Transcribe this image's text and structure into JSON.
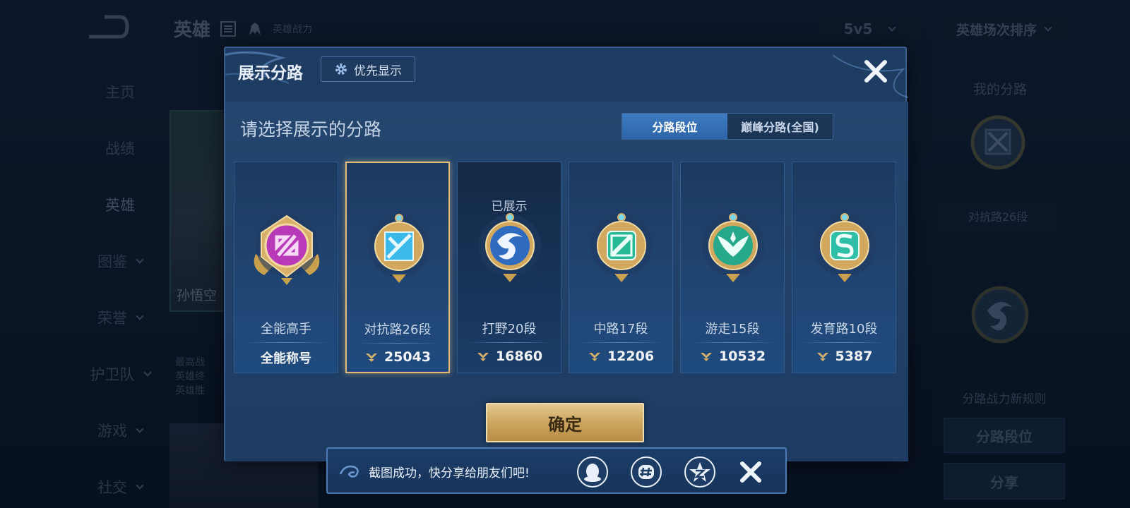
{
  "background": {
    "page_title": "英雄",
    "header_sub": "英雄战力",
    "mode_select": "5v5",
    "sort_select": "英雄场次排序",
    "sidebar": [
      {
        "label": "主页"
      },
      {
        "label": "战绩"
      },
      {
        "label": "英雄"
      },
      {
        "label": "图鉴"
      },
      {
        "label": "荣誉"
      },
      {
        "label": "护卫队"
      },
      {
        "label": "游戏"
      },
      {
        "label": "社交"
      }
    ],
    "hero_name": "孙悟空",
    "hero_info": [
      "最高战",
      "英雄终",
      "英雄胜"
    ],
    "right": {
      "title": "我的分路",
      "rank": "对抗路26段",
      "rules": "分路战力新规则",
      "lane_button": "分路段位",
      "share_button": "分享"
    }
  },
  "modal": {
    "title": "展示分路",
    "priority_button": "优先显示",
    "prompt": "请选择展示的分路",
    "tabs": [
      "分路段位",
      "巅峰分路(全国)"
    ],
    "active_tab": 0,
    "cards": [
      {
        "name": "全能高手",
        "subtitle": "全能称号",
        "score": null,
        "icon": "all-round-emblem",
        "color": "#c43fc4"
      },
      {
        "name": "对抗路26段",
        "score": "25043",
        "icon": "clash-lane-emblem",
        "color": "#3bb8e8",
        "selected": true
      },
      {
        "name": "打野20段",
        "score": "16860",
        "icon": "jungle-dragon-emblem",
        "color": "#3a78c8",
        "shown": true,
        "shown_label": "已展示"
      },
      {
        "name": "中路17段",
        "score": "12206",
        "icon": "mid-lane-emblem",
        "color": "#2fc4a4"
      },
      {
        "name": "游走15段",
        "score": "10532",
        "icon": "roam-wings-emblem",
        "color": "#2fb89a"
      },
      {
        "name": "发育路10段",
        "score": "5387",
        "icon": "farm-lane-emblem",
        "color": "#38c0a8"
      }
    ],
    "confirm_button": "确定"
  },
  "toast": {
    "text": "截图成功，快分享给朋友们吧!",
    "share_targets": [
      "qq-icon",
      "wechat-moments-icon",
      "qzone-icon"
    ]
  }
}
